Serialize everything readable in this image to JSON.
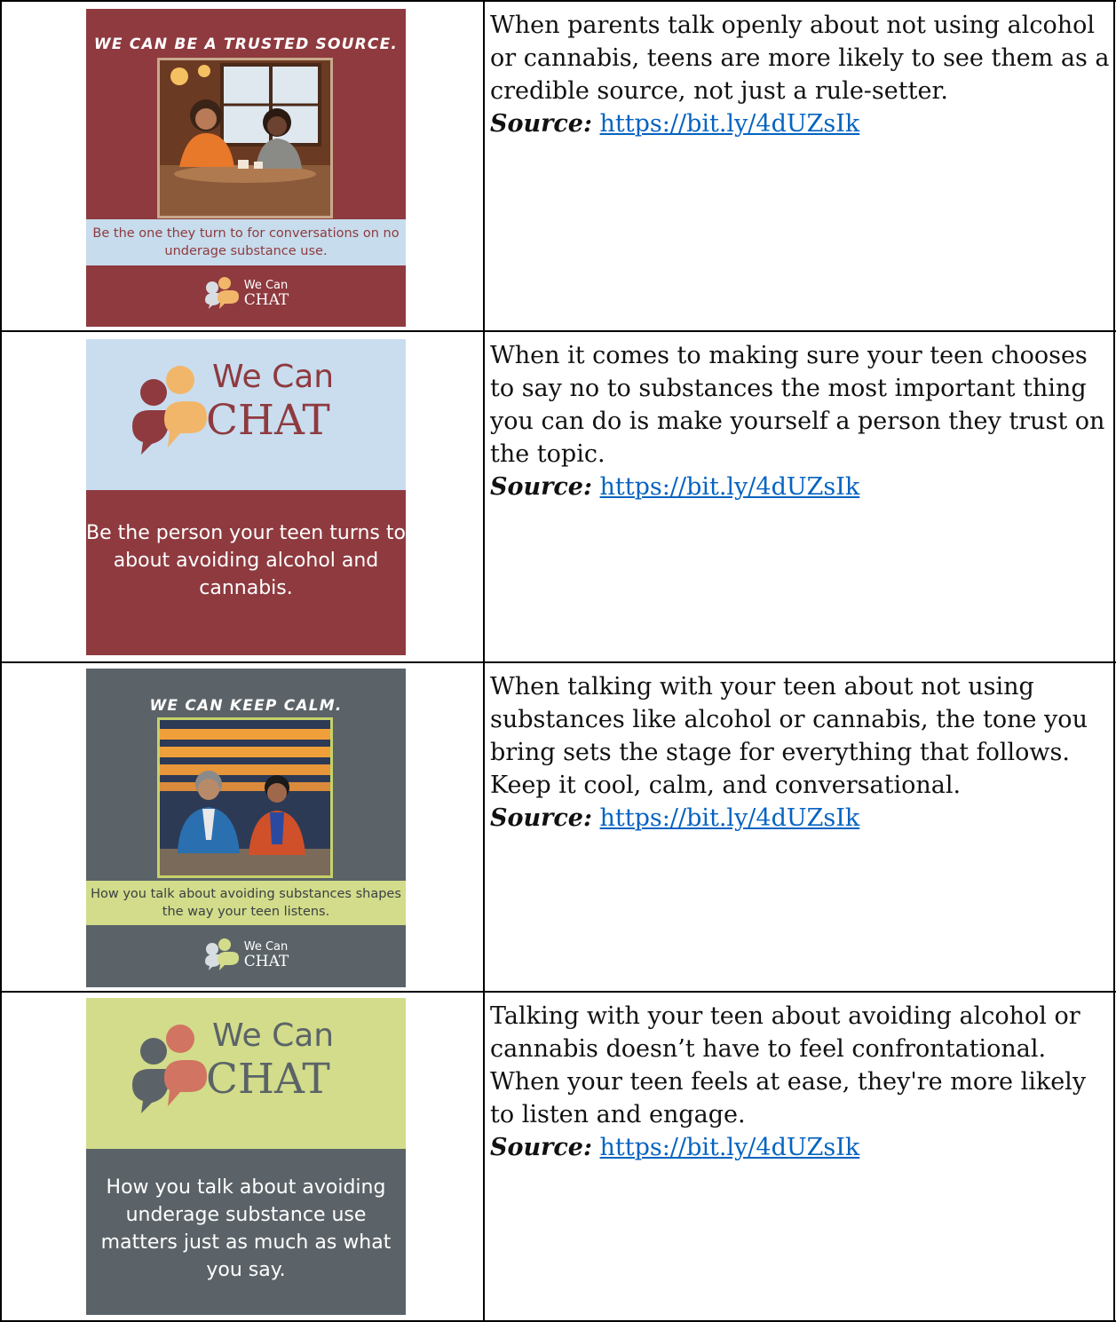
{
  "rows": [
    {
      "poster": {
        "headline": "WE CAN BE A TRUSTED SOURCE.",
        "band_text": "Be the one they turn to for conversations on no underage substance use.",
        "logo_line1": "We Can",
        "logo_line2": "CHAT",
        "bg_color": "#8e3a3f",
        "band_color": "#c7dcec"
      },
      "text": "When parents talk openly about not using alcohol or cannabis, teens are more likely to see them as a credible source, not just a rule-setter.",
      "source_label": "Source:",
      "source_link": "https://bit.ly/4dUZsIk"
    },
    {
      "poster": {
        "logo_line1": "We Can",
        "logo_line2": "CHAT",
        "body_text": "Be the person your teen turns to about avoiding alcohol and cannabis.",
        "top_color": "#c9ddef",
        "bottom_color": "#8e3a3f"
      },
      "text": "When it comes to making sure your teen chooses to say no to substances the most important thing you can do is make yourself a person they trust on the topic.",
      "source_label": "Source:",
      "source_link": "https://bit.ly/4dUZsIk"
    },
    {
      "poster": {
        "headline": "WE CAN KEEP CALM.",
        "band_text": "How you talk about avoiding substances shapes the way your teen listens.",
        "logo_line1": "We Can",
        "logo_line2": "CHAT",
        "bg_color": "#5b6368",
        "band_color": "#d2dc8a"
      },
      "text": "When talking with your teen about not using substances like alcohol or cannabis, the tone you bring sets the stage for everything that follows. Keep it cool, calm, and conversational.",
      "source_label": "Source:",
      "source_link": "https://bit.ly/4dUZsIk"
    },
    {
      "poster": {
        "logo_line1": "We Can",
        "logo_line2": "CHAT",
        "body_text": "How you talk about avoiding underage substance use matters just as much as what you say.",
        "top_color": "#d2dc8a",
        "bottom_color": "#5b6368"
      },
      "text": "Talking with your teen about avoiding alcohol or cannabis doesn’t have to feel confrontational. When your teen feels at ease, they're more likely to listen and engage.",
      "source_label": "Source:",
      "source_link": "https://bit.ly/4dUZsIk"
    }
  ]
}
